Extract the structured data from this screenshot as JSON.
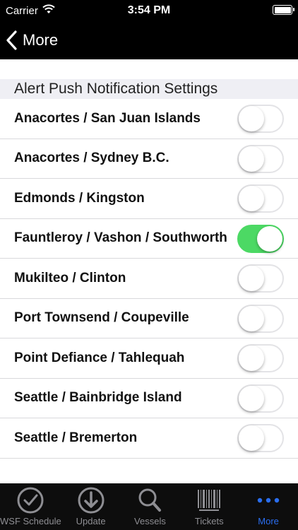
{
  "status_bar": {
    "carrier": "Carrier",
    "time": "3:54 PM"
  },
  "nav": {
    "back_label": "More"
  },
  "section": {
    "title": "Alert Push Notification Settings"
  },
  "routes": [
    {
      "label": "Anacortes / San Juan Islands",
      "enabled": false
    },
    {
      "label": "Anacortes / Sydney B.C.",
      "enabled": false
    },
    {
      "label": "Edmonds / Kingston",
      "enabled": false
    },
    {
      "label": "Fauntleroy / Vashon / Southworth",
      "enabled": true
    },
    {
      "label": "Mukilteo / Clinton",
      "enabled": false
    },
    {
      "label": "Port Townsend / Coupeville",
      "enabled": false
    },
    {
      "label": "Point Defiance / Tahlequah",
      "enabled": false
    },
    {
      "label": "Seattle / Bainbridge Island",
      "enabled": false
    },
    {
      "label": "Seattle / Bremerton",
      "enabled": false
    }
  ],
  "tabs": [
    {
      "label": "WSF Schedule",
      "icon": "clock-check-icon"
    },
    {
      "label": "Update",
      "icon": "download-arrow-icon"
    },
    {
      "label": "Vessels",
      "icon": "magnifier-icon"
    },
    {
      "label": "Tickets",
      "icon": "barcode-icon"
    },
    {
      "label": "More",
      "icon": "more-dots-icon",
      "active": true
    }
  ],
  "colors": {
    "toggle_on": "#4cd964",
    "active_tab": "#2a6ef0",
    "inactive_tab": "#8e8e93"
  }
}
